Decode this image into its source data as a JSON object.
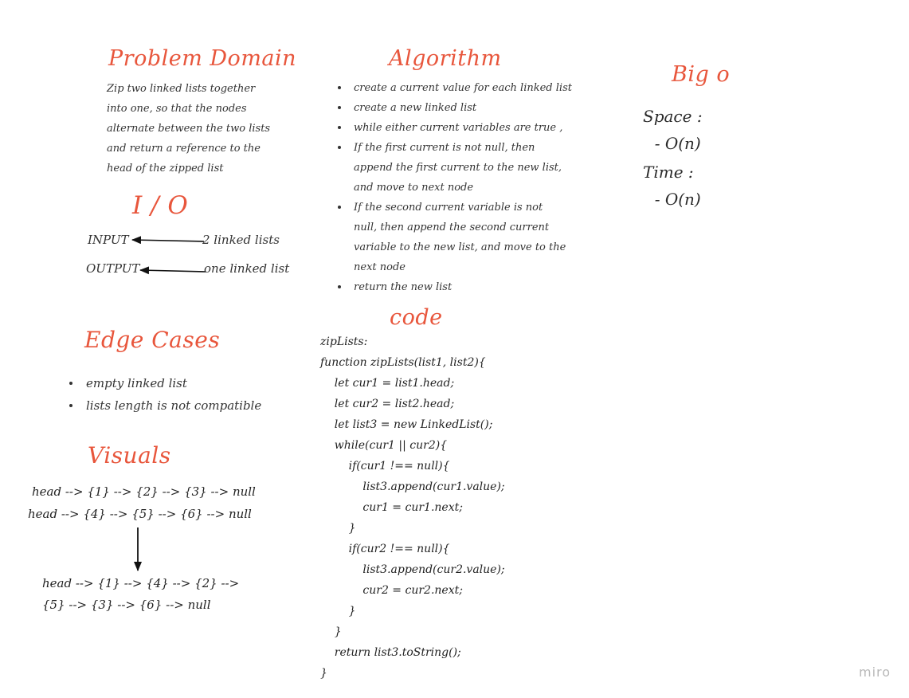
{
  "colors": {
    "heading": "#e8563c",
    "text": "#333333",
    "watermark": "#b8b8b8"
  },
  "problem_domain": {
    "title": "Problem Domain",
    "lines": [
      "Zip two linked lists together",
      "into one, so that the nodes",
      "alternate between the two lists",
      "and return a reference to the",
      "head of the zipped list"
    ]
  },
  "io": {
    "title": "I / O",
    "input_label": "INPUT",
    "input_value": "2 linked lists",
    "output_label": "OUTPUT",
    "output_value": "one linked list"
  },
  "edge_cases": {
    "title": "Edge Cases",
    "items": [
      "empty linked list",
      "lists length is not compatible"
    ]
  },
  "visuals": {
    "title": "Visuals",
    "list1": "head --> {1} --> {2} --> {3} --> null",
    "list2": "head --> {4} --> {5} --> {6} --> null",
    "result_line1": "head --> {1} --> {4} --> {2} -->",
    "result_line2": "{5} --> {3} --> {6} --> null"
  },
  "algorithm": {
    "title": "Algorithm",
    "steps": [
      [
        "create a current value for each linked list"
      ],
      [
        "create a new linked list"
      ],
      [
        "while either current variables are true ,"
      ],
      [
        "If  the first current is not null, then",
        "append the first current to the new list,",
        "and move to next node"
      ],
      [
        "If the second current variable is not",
        "null, then append the second current",
        "variable to the new list, and move to the",
        "next node"
      ],
      [
        "return the new list"
      ]
    ]
  },
  "code": {
    "title": "code",
    "lines": [
      "zipLists:",
      "function zipLists(list1, list2){",
      "    let cur1 = list1.head;",
      "    let cur2 = list2.head;",
      "    let list3 = new LinkedList();",
      "    while(cur1 || cur2){",
      "        if(cur1 !== null){",
      "            list3.append(cur1.value);",
      "            cur1 = cur1.next;",
      "        }",
      "        if(cur2 !== null){",
      "            list3.append(cur2.value);",
      "            cur2 = cur2.next;",
      "        }",
      "    }",
      "    return list3.toString();",
      "}"
    ]
  },
  "big_o": {
    "title": "Big o",
    "space_label": "Space :",
    "space_value": "  - O(n)",
    "time_label": "Time :",
    "time_value": "  - O(n)"
  },
  "watermark": "miro"
}
